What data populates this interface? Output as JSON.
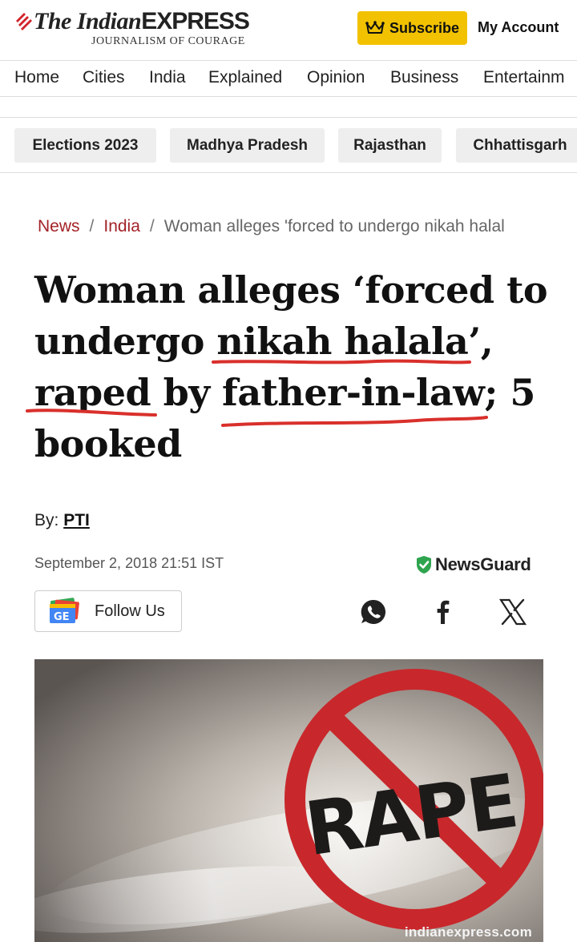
{
  "header": {
    "logo_the": "The Indian",
    "logo_express": "EXPRESS",
    "logo_tagline": "JOURNALISM OF COURAGE",
    "subscribe_label": "Subscribe",
    "subscribe_icon": "crown-icon",
    "account_label": "My Account",
    "brand_color": "#f2c200",
    "accent_color": "#a32228"
  },
  "main_nav": {
    "items": [
      "Home",
      "Cities",
      "India",
      "Explained",
      "Opinion",
      "Business",
      "Entertainm"
    ]
  },
  "topic_chips": {
    "items": [
      "Elections 2023",
      "Madhya Pradesh",
      "Rajasthan",
      "Chhattisgarh"
    ]
  },
  "breadcrumb": {
    "items": [
      "News",
      "India"
    ],
    "separator": "/",
    "current": "Woman alleges 'forced to undergo nikah halal"
  },
  "article": {
    "headline_lines": [
      "Woman alleges ‘forced to",
      "undergo nikah halala’,",
      "raped by father-in-law; 5",
      "booked"
    ],
    "byline_prefix": "By:",
    "author": "PTI",
    "date": "September 2, 2018 21:51 IST",
    "newsguard_label": "NewsGuard",
    "follow_label": "Follow Us",
    "share_icons": [
      "whatsapp-icon",
      "facebook-icon",
      "x-icon"
    ],
    "image_text": "RAPE",
    "image_caption": "indianexpress.com",
    "annotation_color": "#d9302c"
  }
}
